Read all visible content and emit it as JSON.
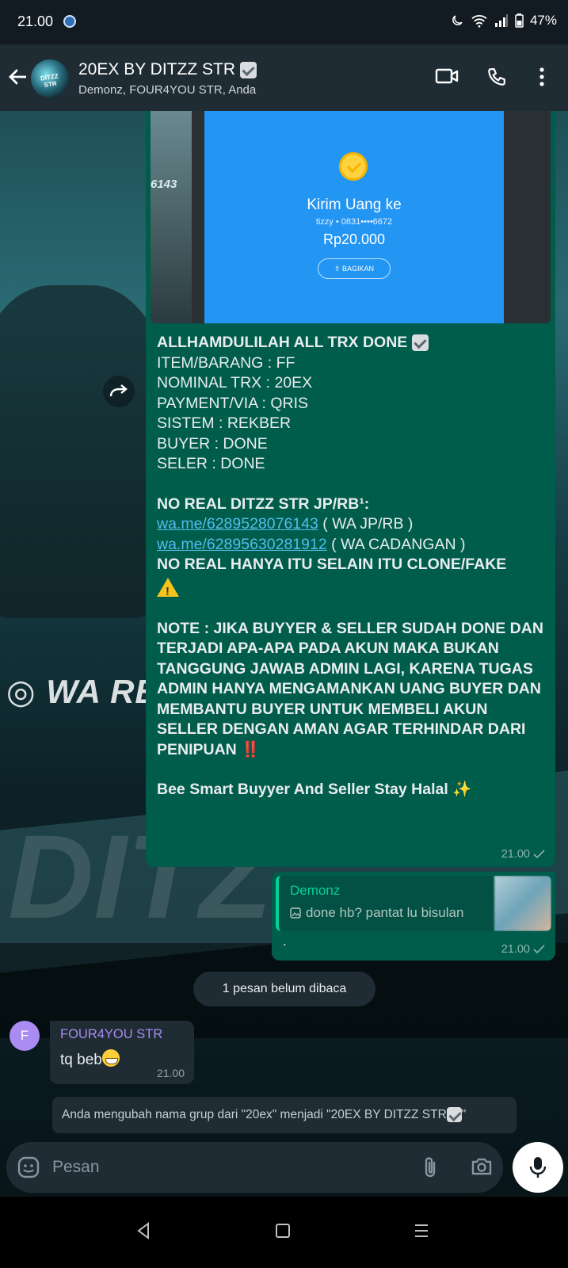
{
  "status_bar": {
    "time": "21.00",
    "battery": "47%"
  },
  "header": {
    "title": "20EX BY DITZZ STR",
    "members": "Demonz, FOUR4YOU STR, Anda",
    "avatar_text": "DITZZ STR"
  },
  "wallpaper": {
    "watermark": "WA RB",
    "big_text": "DITZ",
    "image_label": "6143"
  },
  "shared_image": {
    "title": "Kirim Uang ke",
    "recipient": "tizzy • 0831••••6672",
    "amount": "Rp20.000",
    "share_label": "BAGIKAN"
  },
  "message_main": {
    "line1": "ALLHAMDULILAH ALL TRX DONE",
    "lines": [
      "ITEM/BARANG : FF",
      "NOMINAL TRX : 20EX",
      "PAYMENT/VIA : QRIS",
      "SISTEM : REKBER",
      "BUYER : DONE",
      "SELER : DONE"
    ],
    "no_real_title": "NO REAL DITZZ STR JP/RB¹:",
    "link1": "wa.me/6289528076143",
    "link1_note": " ( WA JP/RB )",
    "link2": "wa.me/62895630281912",
    "link2_note": " ( WA CADANGAN )",
    "no_real_warning": "NO REAL HANYA ITU SELAIN ITU CLONE/FAKE",
    "note": "NOTE : JIKA BUYYER & SELLER SUDAH DONE DAN TERJADI APA-APA PADA AKUN MAKA BUKAN TANGGUNG JAWAB ADMIN LAGI, KARENA TUGAS ADMIN HANYA MENGAMANKAN UANG BUYER DAN MEMBANTU BUYER UNTUK MEMBELI AKUN SELLER DENGAN AMAN AGAR TERHINDAR DARI PENIPUAN",
    "note_emoji": "‼️",
    "closing": "Bee Smart Buyyer And Seller Stay Halal",
    "closing_emoji": "✨",
    "time": "21.00"
  },
  "message_reply": {
    "quoted_author": "Demonz",
    "quoted_text": "done hb? pantat lu bisulan",
    "body": ".",
    "time": "21.00"
  },
  "unread_label": "1 pesan belum dibaca",
  "message_incoming": {
    "avatar_letter": "F",
    "sender": "FOUR4YOU STR",
    "text": "tq beb",
    "time": "21.00"
  },
  "system_message": "Anda mengubah nama grup dari \"20ex\" menjadi \"20EX BY DITZZ STR",
  "system_message_end": "\"",
  "composer": {
    "placeholder": "Pesan"
  },
  "colors": {
    "header_bg": "#1f2c34",
    "outgoing_bubble": "#005c4b",
    "incoming_bubble": "#1f2c34",
    "link": "#53bdeb",
    "accent": "#06cf9c",
    "sender_name": "#a98bf2"
  },
  "icons": [
    "back-arrow-icon",
    "video-call-icon",
    "phone-icon",
    "more-vert-icon",
    "forward-icon",
    "emoji-icon",
    "attach-icon",
    "camera-icon",
    "mic-icon",
    "image-icon",
    "double-check-icon"
  ]
}
